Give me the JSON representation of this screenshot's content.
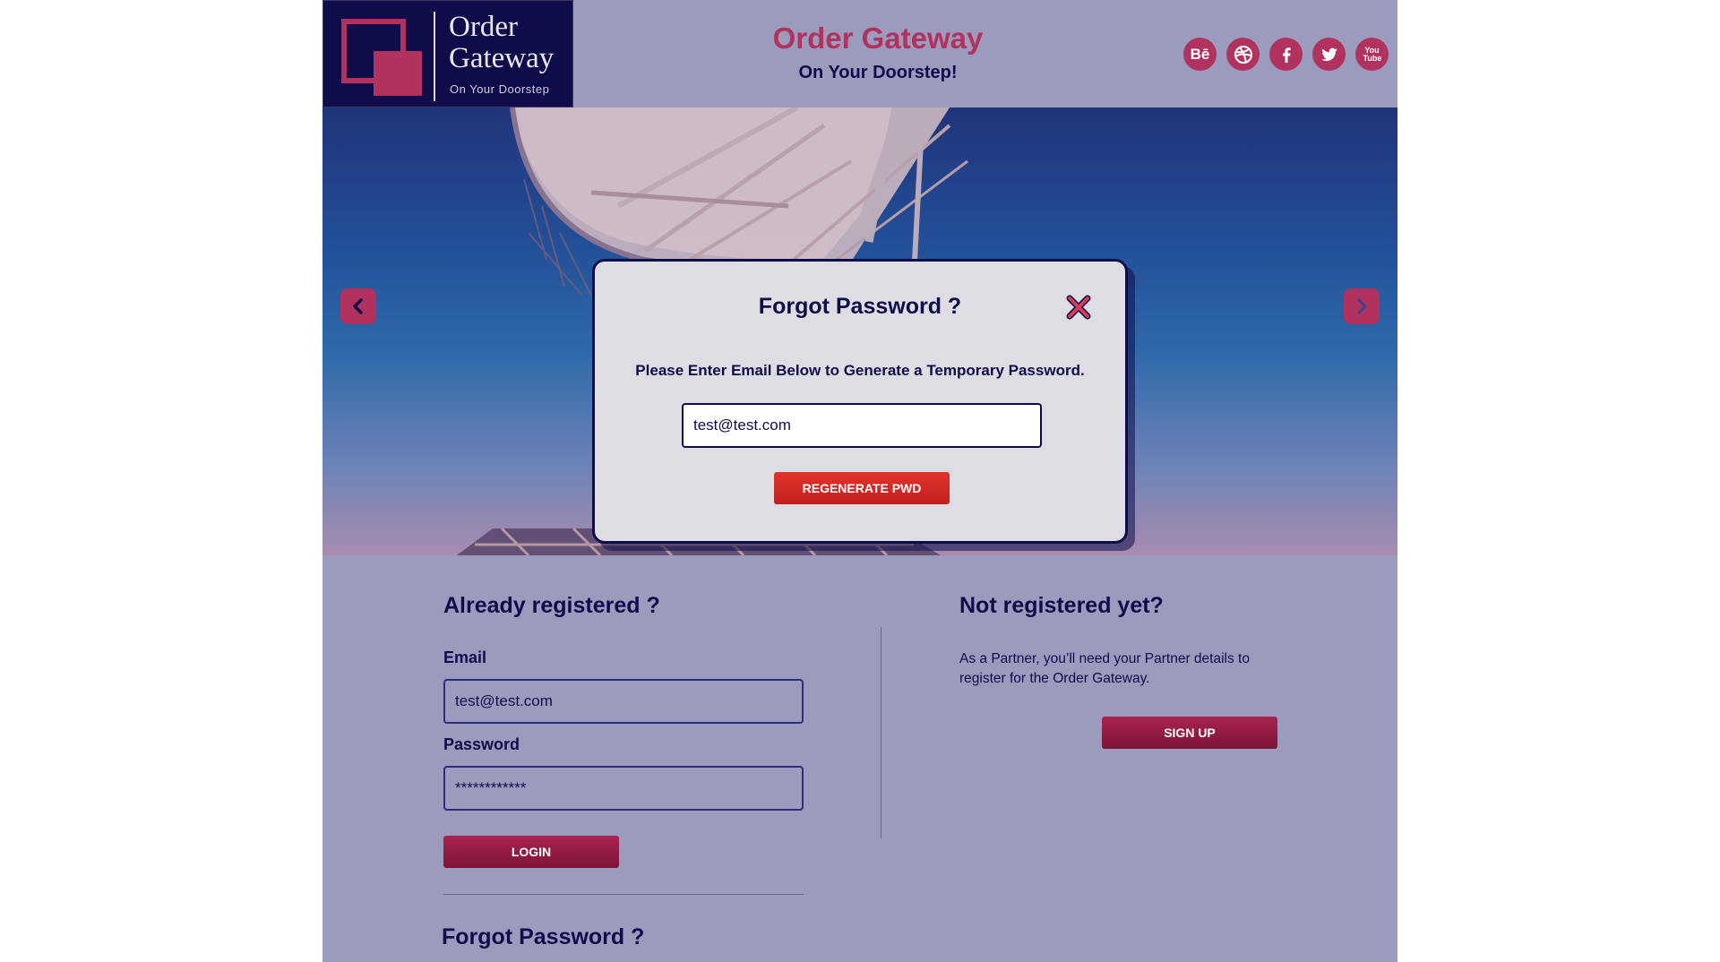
{
  "header": {
    "logo": {
      "line1": "Order",
      "line2": "Gateway",
      "subtitle": "On Your Doorstep"
    },
    "title": "Order Gateway",
    "tagline": "On Your Doorstep!",
    "socials": [
      {
        "name": "behance",
        "label": "Bē"
      },
      {
        "name": "dribbble",
        "label": ""
      },
      {
        "name": "facebook",
        "label": ""
      },
      {
        "name": "twitter",
        "label": ""
      },
      {
        "name": "youtube",
        "label": "You Tube"
      }
    ]
  },
  "modal": {
    "title": "Forgot Password ?",
    "instructions": "Please Enter Email Below to Generate a Temporary Password.",
    "email_value": "test@test.com",
    "button_label": "REGENERATE PWD"
  },
  "login": {
    "heading": "Already registered ?",
    "email_label": "Email",
    "email_value": "test@test.com",
    "password_label": "Password",
    "password_value": "************",
    "button_label": "LOGIN",
    "forgot_label": "Forgot Password ?"
  },
  "register": {
    "heading": "Not registered yet?",
    "text": "As a Partner, you’ll need your Partner details to register for the Order Gateway.",
    "button_label": "SIGN UP"
  },
  "colors": {
    "primary": "#0f0c4a",
    "accent": "#b2325f",
    "background": "#9a9bbd",
    "modal_button": "#d52a26"
  }
}
